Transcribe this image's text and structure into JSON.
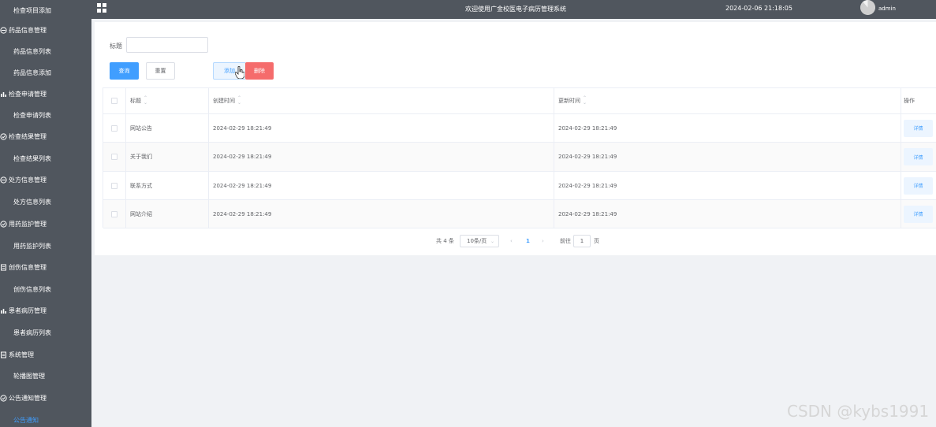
{
  "sidebar": {
    "items": [
      {
        "label": "检查项目添加",
        "type": "sub",
        "icon": ""
      },
      {
        "label": "药品信息管理",
        "type": "group",
        "icon": "circle-icon"
      },
      {
        "label": "药品信息列表",
        "type": "sub",
        "icon": ""
      },
      {
        "label": "药品信息添加",
        "type": "sub",
        "icon": ""
      },
      {
        "label": "检查申请管理",
        "type": "group",
        "icon": "chart-icon"
      },
      {
        "label": "检查申请列表",
        "type": "sub",
        "icon": ""
      },
      {
        "label": "检查结果管理",
        "type": "group",
        "icon": "check-circle-icon"
      },
      {
        "label": "检查结果列表",
        "type": "sub",
        "icon": ""
      },
      {
        "label": "处方信息管理",
        "type": "group",
        "icon": "circle-icon"
      },
      {
        "label": "处方信息列表",
        "type": "sub",
        "icon": ""
      },
      {
        "label": "用药监护管理",
        "type": "group",
        "icon": "check-circle-icon"
      },
      {
        "label": "用药监护列表",
        "type": "sub",
        "icon": ""
      },
      {
        "label": "创伤信息管理",
        "type": "group",
        "icon": "document-icon"
      },
      {
        "label": "创伤信息列表",
        "type": "sub",
        "icon": ""
      },
      {
        "label": "患者病历管理",
        "type": "group",
        "icon": "chart-icon"
      },
      {
        "label": "患者病历列表",
        "type": "sub",
        "icon": ""
      },
      {
        "label": "系统管理",
        "type": "group",
        "icon": "document-icon"
      },
      {
        "label": "轮播图管理",
        "type": "sub",
        "icon": ""
      },
      {
        "label": "公告通知管理",
        "type": "group",
        "icon": "check-circle-icon"
      },
      {
        "label": "公告通知",
        "type": "sub",
        "icon": "",
        "active": true
      }
    ]
  },
  "header": {
    "title": "欢迎使用广金校医电子病历管理系统",
    "datetime": "2024-02-06 21:18:05",
    "username": "admin"
  },
  "search": {
    "label": "标题",
    "value": "",
    "placeholder": ""
  },
  "buttons": {
    "query": "查询",
    "reset": "重置",
    "add": "添加",
    "delete": "删除"
  },
  "table": {
    "columns": {
      "title": "标题",
      "created": "创建时间",
      "updated": "更新时间",
      "actions": "操作"
    },
    "rows": [
      {
        "title": "网站公告",
        "created": "2024-02-29 18:21:49",
        "updated": "2024-02-29 18:21:49",
        "action": "详情"
      },
      {
        "title": "关于我们",
        "created": "2024-02-29 18:21:49",
        "updated": "2024-02-29 18:21:49",
        "action": "详情"
      },
      {
        "title": "联系方式",
        "created": "2024-02-29 18:21:49",
        "updated": "2024-02-29 18:21:49",
        "action": "详情"
      },
      {
        "title": "网站介绍",
        "created": "2024-02-29 18:21:49",
        "updated": "2024-02-29 18:21:49",
        "action": "详情"
      }
    ]
  },
  "pagination": {
    "total": "共 4 条",
    "page_size": "10条/页",
    "current": "1",
    "goto_label": "前往",
    "goto_value": "1",
    "page_suffix": "页"
  },
  "watermark": "CSDN @kybs1991",
  "colors": {
    "sidebar_bg": "#50565e",
    "primary": "#409eff",
    "danger": "#f56c6c",
    "active_menu": "#409eff"
  }
}
